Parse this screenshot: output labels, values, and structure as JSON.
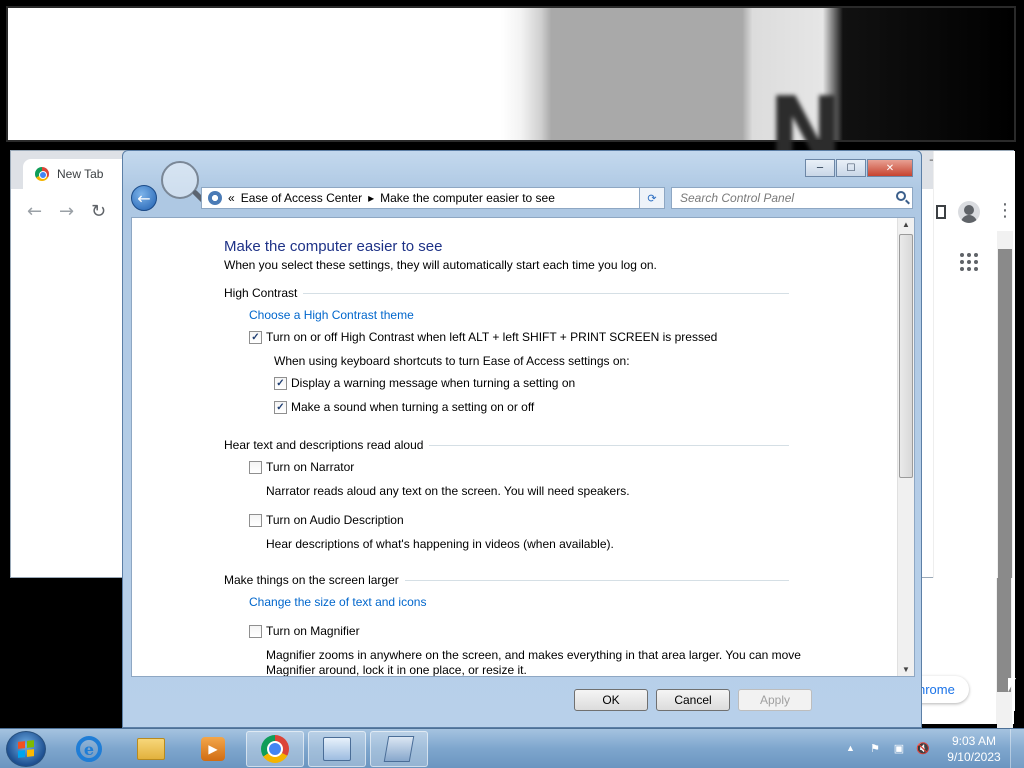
{
  "magnifier": {
    "glyph": "N"
  },
  "chrome": {
    "tab_title": "New Tab",
    "nav": {
      "back": "←",
      "forward": "→",
      "reload": "↻"
    },
    "menu_glyph": "⋮",
    "window_buttons": {
      "minimize": "─",
      "maximize": "☐",
      "close": "✕"
    },
    "customize_label": "Customize Chrome",
    "customize_visible": "hrome"
  },
  "control_panel": {
    "window_buttons": {
      "minimize": "─",
      "maximize": "☐",
      "close": "✕"
    },
    "address": {
      "prefix": "«",
      "crumbs": [
        "Ease of Access Center",
        "Make the computer easier to see"
      ],
      "separator": "▸",
      "dropdown": "▼"
    },
    "refresh_glyph": "⟳",
    "search_placeholder": "Search Control Panel",
    "title": "Make the computer easier to see",
    "subtitle": "When you select these settings, they will automatically start each time you log on.",
    "sections": {
      "high_contrast": {
        "heading": "High Contrast",
        "link": "Choose a High Contrast theme",
        "toggle": {
          "label": "Turn on or off High Contrast when left ALT + left SHIFT + PRINT SCREEN is pressed",
          "checked": true
        },
        "shortcut_note": "When using keyboard shortcuts to turn Ease of Access settings on:",
        "warning": {
          "label": "Display a warning message when turning a setting on",
          "checked": true
        },
        "sound": {
          "label": "Make a sound when turning a setting on or off",
          "checked": true
        }
      },
      "read_aloud": {
        "heading": "Hear text and descriptions read aloud",
        "narrator": {
          "label": "Turn on Narrator",
          "checked": false,
          "description": "Narrator reads aloud any text on the screen. You will need speakers."
        },
        "audio_description": {
          "label": "Turn on Audio Description",
          "checked": false,
          "description": "Hear descriptions of what's happening in videos (when available)."
        }
      },
      "larger": {
        "heading": "Make things on the screen larger",
        "link": "Change the size of text and icons",
        "magnifier": {
          "label": "Turn on Magnifier",
          "checked": false,
          "description_line1": "Magnifier zooms in anywhere on the screen, and makes everything in that area larger. You can move",
          "description_line2": "Magnifier around, lock it in one place, or resize it."
        }
      }
    },
    "check_glyph": "✓",
    "buttons": {
      "ok": "OK",
      "cancel": "Cancel",
      "apply": "Apply"
    }
  },
  "taskbar": {
    "ie_glyph": "e",
    "wmp_glyph": "▶",
    "tray_arrow": "▲",
    "tray_icons": [
      "flag-icon",
      "network-icon",
      "volume-muted-icon"
    ],
    "tray_glyphs": [
      "⚑",
      "▣",
      "🔇"
    ],
    "time": "9:03 AM",
    "date": "9/10/2023"
  }
}
